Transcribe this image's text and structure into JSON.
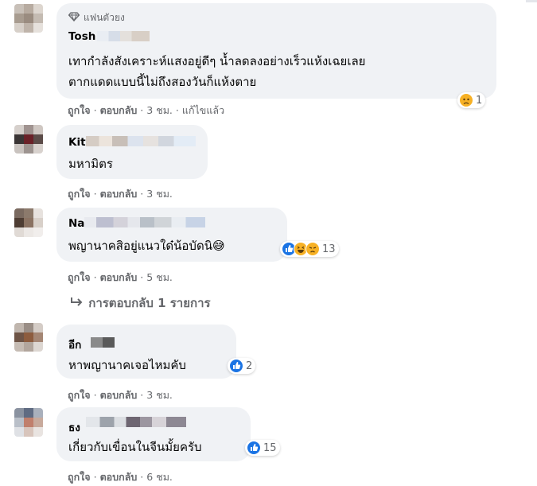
{
  "comments": [
    {
      "name": "Tosh",
      "badge": "แฟนตัวยง",
      "lines": [
        "เทากำลังสังเคราะห์แสงอยู่ดีๆ น้ำลดลงอย่างเร็วแห้งเฉยเลย",
        "ตากแดดแบบนี้ไม่ถึงสองวันก็แห้งตาย"
      ],
      "like": "ถูกใจ",
      "reply": "ตอบกลับ",
      "time": "3 ชม.",
      "edited": "แก้ไขแล้ว",
      "reaction_count": "1"
    },
    {
      "name": "Kit",
      "lines": [
        "มหามิตร"
      ],
      "like": "ถูกใจ",
      "reply": "ตอบกลับ",
      "time": "3 ชม."
    },
    {
      "name": "Na",
      "lines": [
        "พญานาคสิอยู่แนวใด๋น้อบัดนิ😅"
      ],
      "like": "ถูกใจ",
      "reply": "ตอบกลับ",
      "time": "5 ชม.",
      "reaction_count": "13",
      "replies_label": "การตอบกลับ 1 รายการ"
    },
    {
      "name": "อีก",
      "lines": [
        "หาพญานาคเจอไหมคับ"
      ],
      "like": "ถูกใจ",
      "reply": "ตอบกลับ",
      "time": "3 ชม.",
      "reaction_count": "2"
    },
    {
      "name": "ธง",
      "lines": [
        "เกี่ยวกับเขื่อนในจีนมั้ยครับ"
      ],
      "like": "ถูกใจ",
      "reply": "ตอบกลับ",
      "time": "6 ชม.",
      "reaction_count": "15"
    }
  ],
  "colors": {
    "bubble": "#f0f2f5",
    "meta": "#65676b",
    "like_blue": "#1b74e4",
    "sad_yellow": "#f7b125"
  }
}
